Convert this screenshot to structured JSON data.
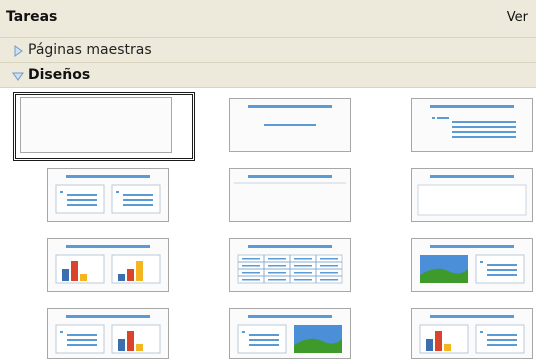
{
  "header": {
    "title": "Tareas",
    "view_label": "Ver"
  },
  "sections": [
    {
      "label": "Páginas maestras",
      "expanded": false
    },
    {
      "label": "Diseños",
      "expanded": true
    }
  ],
  "layouts": [
    {
      "kind": "blank",
      "selected": true
    },
    {
      "kind": "title-subtitle"
    },
    {
      "kind": "title-content"
    },
    {
      "kind": "title-2-content"
    },
    {
      "kind": "title-only"
    },
    {
      "kind": "centered-text"
    },
    {
      "kind": "title-2-charts"
    },
    {
      "kind": "title-table"
    },
    {
      "kind": "title-image-content"
    },
    {
      "kind": "title-content-chart"
    },
    {
      "kind": "title-content-image"
    },
    {
      "kind": "title-chart-content"
    }
  ],
  "colors": {
    "panel": "#edeadb",
    "accent": "#5b9bd5",
    "arrow": "#8fb4d8"
  }
}
